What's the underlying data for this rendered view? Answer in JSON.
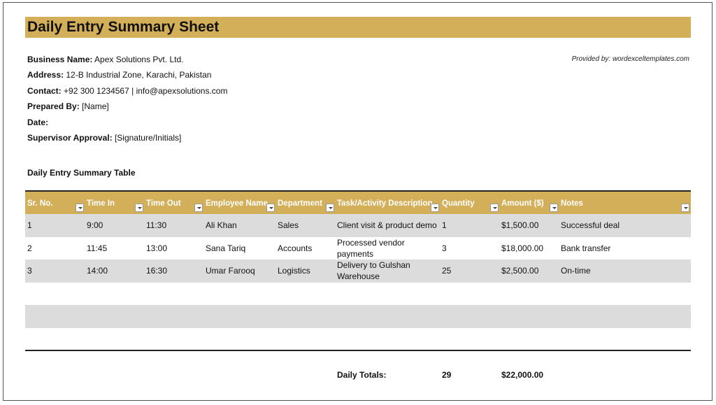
{
  "title": "Daily Entry Summary Sheet",
  "provided_by": "Provided by: wordexceltemplates.com",
  "info": {
    "business_label": "Business Name:",
    "business_value": "Apex Solutions Pvt. Ltd.",
    "address_label": "Address:",
    "address_value": "12-B Industrial Zone, Karachi, Pakistan",
    "contact_label": "Contact:",
    "contact_value": "+92 300 1234567 | info@apexsolutions.com",
    "prepared_label": "Prepared By:",
    "prepared_value": "[Name]",
    "date_label": "Date:",
    "date_value": "",
    "approval_label": "Supervisor Approval:",
    "approval_value": "[Signature/Initials]"
  },
  "table_title": "Daily Entry Summary Table",
  "columns": [
    "Sr. No.",
    "Time In",
    "Time Out",
    "Employee Name",
    "Department",
    "Task/Activity Description",
    "Quantity",
    "Amount ($)",
    "Notes"
  ],
  "rows": [
    {
      "sr": "1",
      "time_in": "9:00",
      "time_out": "11:30",
      "employee": "Ali Khan",
      "department": "Sales",
      "task_line1": "Client visit & product demo",
      "task_line2": "",
      "quantity": "1",
      "amount": "$1,500.00",
      "notes": "Successful deal"
    },
    {
      "sr": "2",
      "time_in": "11:45",
      "time_out": "13:00",
      "employee": "Sana Tariq",
      "department": "Accounts",
      "task_line1": "Processed vendor",
      "task_line2": "payments",
      "quantity": "3",
      "amount": "$18,000.00",
      "notes": "Bank transfer"
    },
    {
      "sr": "3",
      "time_in": "14:00",
      "time_out": "16:30",
      "employee": "Umar Farooq",
      "department": "Logistics",
      "task_line1": "Delivery to Gulshan",
      "task_line2": "Warehouse",
      "quantity": "25",
      "amount": "$2,500.00",
      "notes": "On-time"
    }
  ],
  "totals": {
    "label": "Daily Totals:",
    "quantity": "29",
    "amount": "$22,000.00"
  },
  "colors": {
    "header_gold": "#d4af5a",
    "row_shade": "#dcdcdc"
  }
}
